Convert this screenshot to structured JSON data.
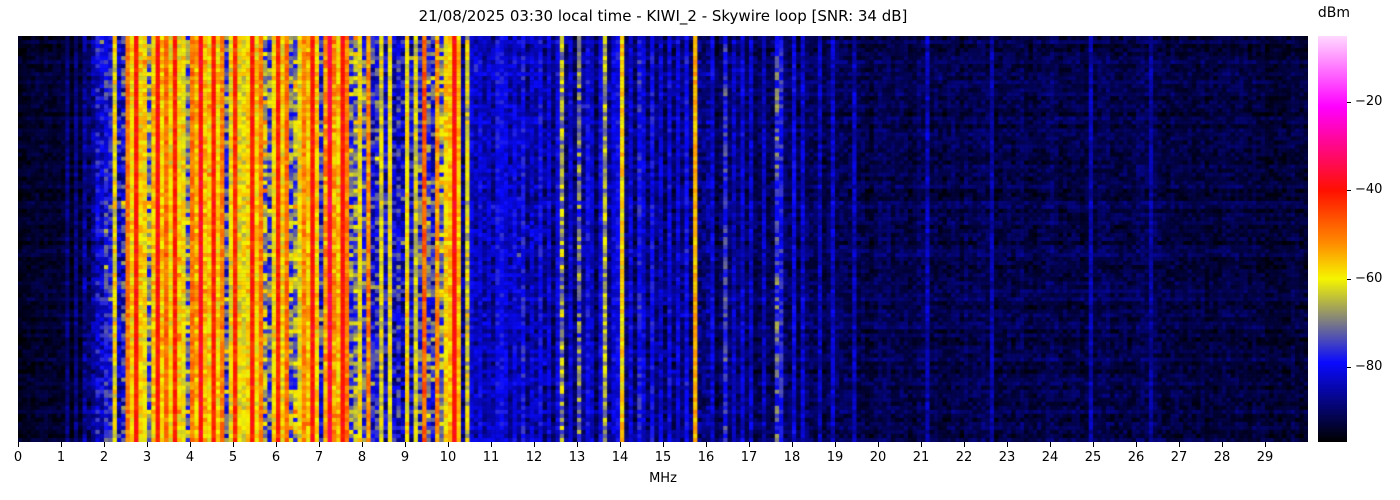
{
  "station": {
    "datetime_local": "21/08/2025 03:30",
    "receiver_name": "KIWI_2",
    "antenna": "Skywire loop",
    "snr_label": "SNR: 34 dB"
  },
  "chart_data": {
    "type": "heatmap",
    "subtype": "radio_spectrum_waterfall",
    "title": "21/08/2025 03:30 local time - KIWI_2 - Skywire loop [SNR: 34 dB]",
    "xlabel": "MHz",
    "x_range_mhz": [
      0,
      30
    ],
    "x_ticks": [
      "0",
      "1",
      "2",
      "3",
      "4",
      "5",
      "6",
      "7",
      "8",
      "9",
      "10",
      "11",
      "12",
      "13",
      "14",
      "15",
      "16",
      "17",
      "18",
      "19",
      "20",
      "21",
      "22",
      "23",
      "24",
      "25",
      "26",
      "27",
      "28",
      "29"
    ],
    "y_axis": {
      "label": "",
      "ticks_visible": false,
      "meaning": "time (waterfall rows)"
    },
    "grid": {
      "cols": 300,
      "rows": 101
    },
    "seed": 1234,
    "colorbar": {
      "label": "dBm",
      "vmin": -97,
      "vmax": -5,
      "tick_values": [
        -20,
        -40,
        -60,
        -80
      ],
      "tick_labels": [
        "−20",
        "−40",
        "−60",
        "−80"
      ],
      "stops": [
        [
          -97,
          "#000000"
        ],
        [
          -79,
          "#0a0aff"
        ],
        [
          -60,
          "#f5f500"
        ],
        [
          -52,
          "#ff8c00"
        ],
        [
          -40,
          "#ff1000"
        ],
        [
          -21,
          "#ff00ff"
        ],
        [
          -5,
          "#ffd9ff"
        ]
      ]
    },
    "noise_bands": [
      {
        "from": 0.0,
        "to": 1.5,
        "base": -94.0,
        "sigma": 1.6,
        "col_var": 1.0,
        "spike_prob": 0.0,
        "spike_db": 0,
        "dead_prob": 0.0
      },
      {
        "from": 1.5,
        "to": 1.85,
        "base": -88.5,
        "sigma": 3.5,
        "col_var": 2.5,
        "spike_prob": 0.02,
        "spike_db": 8,
        "dead_prob": 0.05
      },
      {
        "from": 1.85,
        "to": 2.45,
        "base": -81.0,
        "sigma": 5.5,
        "col_var": 4.0,
        "spike_prob": 0.1,
        "spike_db": 10,
        "dead_prob": 0.06
      },
      {
        "from": 2.45,
        "to": 7.95,
        "base": -73.0,
        "sigma": 8.0,
        "col_var": 6.0,
        "spike_prob": 0.22,
        "spike_db": 12,
        "dead_prob": 0.05
      },
      {
        "from": 7.95,
        "to": 9.35,
        "base": -79.0,
        "sigma": 7.0,
        "col_var": 5.0,
        "spike_prob": 0.12,
        "spike_db": 10,
        "dead_prob": 0.04
      },
      {
        "from": 9.35,
        "to": 10.25,
        "base": -75.0,
        "sigma": 8.0,
        "col_var": 5.0,
        "spike_prob": 0.15,
        "spike_db": 10,
        "dead_prob": 0.03
      },
      {
        "from": 10.25,
        "to": 12.3,
        "base": -86.0,
        "sigma": 4.0,
        "col_var": 2.5,
        "spike_prob": 0.04,
        "spike_db": 8,
        "dead_prob": 0.0
      },
      {
        "from": 12.3,
        "to": 16.1,
        "base": -88.0,
        "sigma": 3.5,
        "col_var": 2.0,
        "spike_prob": 0.03,
        "spike_db": 8,
        "dead_prob": 0.0
      },
      {
        "from": 16.1,
        "to": 19.5,
        "base": -90.5,
        "sigma": 2.6,
        "col_var": 1.5,
        "spike_prob": 0.01,
        "spike_db": 6,
        "dead_prob": 0.0
      },
      {
        "from": 19.5,
        "to": 27.0,
        "base": -91.5,
        "sigma": 2.3,
        "col_var": 1.2,
        "spike_prob": 0.005,
        "spike_db": 5,
        "dead_prob": 0.0
      },
      {
        "from": 27.0,
        "to": 30.0,
        "base": -92.5,
        "sigma": 2.0,
        "col_var": 1.0,
        "spike_prob": 0.003,
        "spike_db": 4,
        "dead_prob": 0.0
      }
    ],
    "crash_rows": {
      "prob": 0.055,
      "min_db": 4,
      "max_db": 10,
      "row_jitter_db": 1.6
    },
    "carriers": [
      [
        1.1,
        -88,
        3
      ],
      [
        1.25,
        -88,
        3
      ],
      [
        2.65,
        -41,
        3
      ],
      [
        3.2,
        -40,
        3
      ],
      [
        3.62,
        -42,
        3
      ],
      [
        4.18,
        -38,
        3
      ],
      [
        4.46,
        -41,
        3
      ],
      [
        5.02,
        -43,
        3
      ],
      [
        5.4,
        -41,
        3
      ],
      [
        6.0,
        -42,
        3
      ],
      [
        6.79,
        -40,
        3
      ],
      [
        7.21,
        -36,
        4
      ],
      [
        7.45,
        -40,
        3
      ],
      [
        10.14,
        -39,
        2
      ],
      [
        2.5,
        -50,
        4
      ],
      [
        3.4,
        -49,
        4
      ],
      [
        3.95,
        -50,
        4
      ],
      [
        4.65,
        -51,
        4
      ],
      [
        5.6,
        -50,
        4
      ],
      [
        6.2,
        -49,
        4
      ],
      [
        6.6,
        -51,
        4
      ],
      [
        7.6,
        -50,
        4
      ],
      [
        8.1,
        -52,
        5
      ],
      [
        9.4,
        -48,
        5
      ],
      [
        9.65,
        -52,
        5
      ],
      [
        2.2,
        -60,
        6
      ],
      [
        2.85,
        -58,
        5
      ],
      [
        3.05,
        -61,
        5
      ],
      [
        3.75,
        -59,
        5
      ],
      [
        4.3,
        -60,
        5
      ],
      [
        4.95,
        -58,
        5
      ],
      [
        5.15,
        -61,
        5
      ],
      [
        5.9,
        -59,
        5
      ],
      [
        6.45,
        -60,
        5
      ],
      [
        7.05,
        -58,
        5
      ],
      [
        7.85,
        -60,
        5
      ],
      [
        8.35,
        -62,
        5
      ],
      [
        8.6,
        -60,
        5
      ],
      [
        9.0,
        -59,
        5
      ],
      [
        9.2,
        -62,
        5
      ],
      [
        9.85,
        -58,
        5
      ],
      [
        10.05,
        -60,
        5
      ],
      [
        10.35,
        -63,
        7
      ],
      [
        11.15,
        -80,
        4
      ],
      [
        12.6,
        -67,
        9
      ],
      [
        13.0,
        -72,
        9
      ],
      [
        13.58,
        -66,
        7
      ],
      [
        14.0,
        -58,
        5
      ],
      [
        15.74,
        -55,
        3
      ],
      [
        16.35,
        -76,
        6
      ],
      [
        10.45,
        -82,
        4
      ],
      [
        10.7,
        -81,
        4
      ],
      [
        10.9,
        -83,
        4
      ],
      [
        11.05,
        -80,
        4
      ],
      [
        11.3,
        -82,
        4
      ],
      [
        11.5,
        -81,
        4
      ],
      [
        11.65,
        -79,
        5
      ],
      [
        11.85,
        -83,
        4
      ],
      [
        12.1,
        -80,
        4
      ],
      [
        12.3,
        -82,
        4
      ],
      [
        12.45,
        -81,
        4
      ],
      [
        12.8,
        -82,
        4
      ],
      [
        13.15,
        -80,
        4
      ],
      [
        13.3,
        -83,
        4
      ],
      [
        13.45,
        -81,
        4
      ],
      [
        13.75,
        -82,
        4
      ],
      [
        13.9,
        -80,
        4
      ],
      [
        14.15,
        -82,
        4
      ],
      [
        14.35,
        -78,
        5
      ],
      [
        14.5,
        -82,
        4
      ],
      [
        14.65,
        -80,
        4
      ],
      [
        14.9,
        -83,
        4
      ],
      [
        15.05,
        -81,
        4
      ],
      [
        15.3,
        -82,
        4
      ],
      [
        15.45,
        -80,
        4
      ],
      [
        16.05,
        -82,
        4
      ],
      [
        16.6,
        -84,
        4
      ],
      [
        16.8,
        -82,
        4
      ],
      [
        17.0,
        -83,
        4
      ],
      [
        17.3,
        -84,
        4
      ],
      [
        17.55,
        -74,
        8
      ],
      [
        17.7,
        -78,
        5
      ],
      [
        18.0,
        -81,
        4
      ],
      [
        18.15,
        -83,
        4
      ],
      [
        18.6,
        -84,
        4
      ],
      [
        18.9,
        -83,
        4
      ],
      [
        19.35,
        -84,
        4
      ],
      [
        21.05,
        -84,
        4
      ],
      [
        22.6,
        -85,
        3
      ],
      [
        24.9,
        -85,
        3
      ],
      [
        26.3,
        -86,
        3
      ]
    ]
  }
}
